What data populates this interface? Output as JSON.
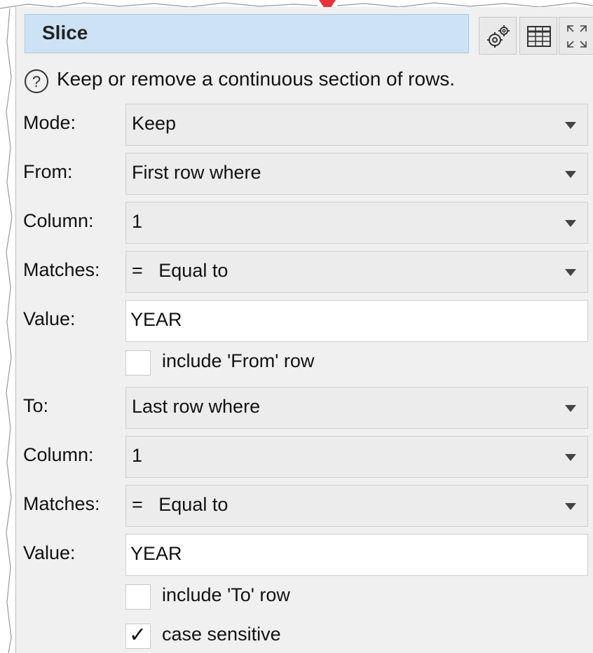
{
  "panel": {
    "title": "Slice",
    "help_text": "Keep or remove a continuous section of rows."
  },
  "toolbar": {
    "buttons": [
      "gear-settings",
      "table-view",
      "expand"
    ]
  },
  "fields": {
    "mode": {
      "label": "Mode:",
      "value": "Keep"
    },
    "from": {
      "label": "From:",
      "value": "First row where"
    },
    "from_column": {
      "label": "Column:",
      "value": "1"
    },
    "from_matches": {
      "label": "Matches:",
      "value": "=   Equal to"
    },
    "from_value": {
      "label": "Value:",
      "value": "YEAR"
    },
    "include_from": {
      "label": "include 'From' row",
      "checked": false
    },
    "to": {
      "label": "To:",
      "value": "Last row where"
    },
    "to_column": {
      "label": "Column:",
      "value": "1"
    },
    "to_matches": {
      "label": "Matches:",
      "value": "=   Equal to"
    },
    "to_value": {
      "label": "Value:",
      "value": "YEAR"
    },
    "include_to": {
      "label": "include 'To' row",
      "checked": false
    },
    "case_sensitive": {
      "label": "case sensitive",
      "checked": true
    }
  },
  "colors": {
    "title_bg": "#cde3f5",
    "panel_bg": "#f0f0f0",
    "pointer": "#e8333a"
  }
}
